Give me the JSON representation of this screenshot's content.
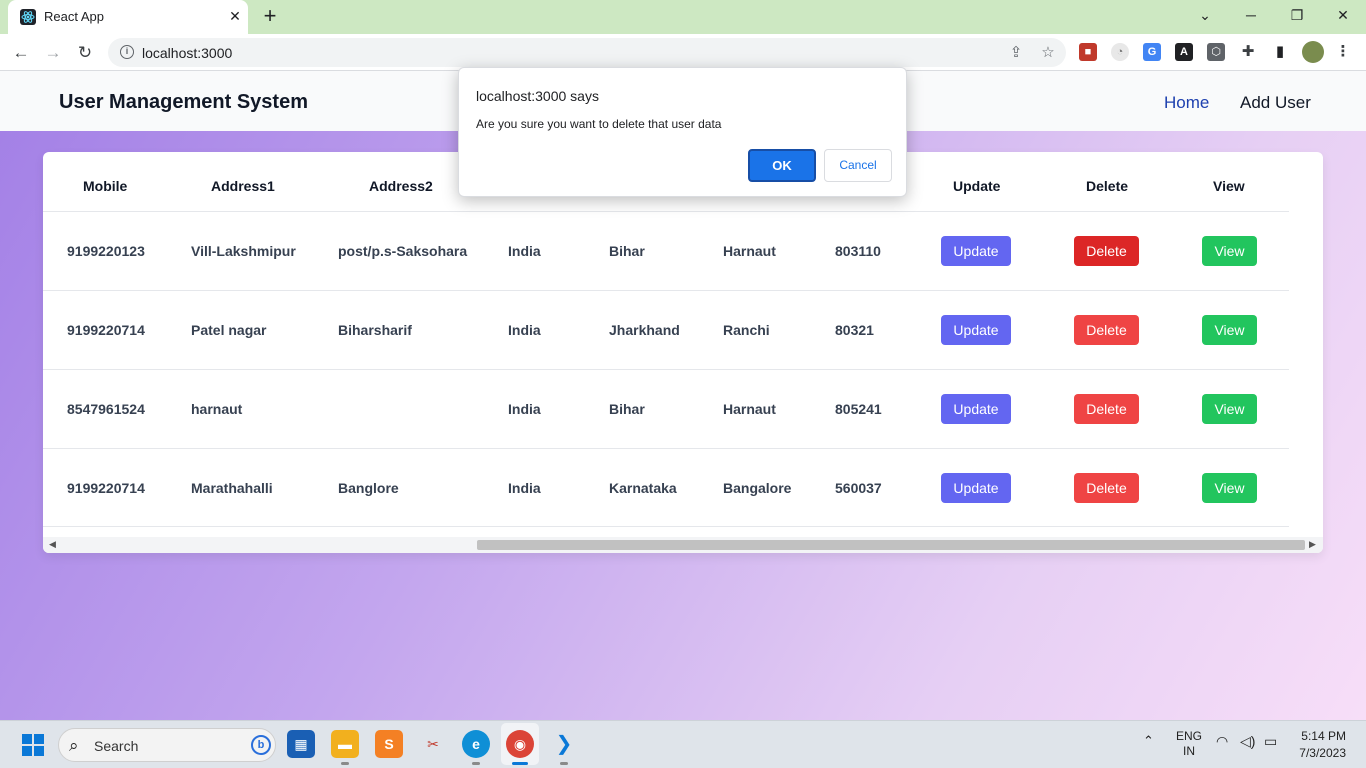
{
  "browser": {
    "tab_title": "React App",
    "url": "localhost:3000"
  },
  "app": {
    "brand": "User Management System",
    "nav": {
      "home": "Home",
      "add_user": "Add User"
    },
    "accent_colors": {
      "update": "#6366f1",
      "delete": "#ef4444",
      "view": "#22c55e",
      "home_link": "#1e40af"
    }
  },
  "table": {
    "headers": [
      "Mobile",
      "Address1",
      "Address2",
      "Update",
      "Delete",
      "View"
    ],
    "rows": [
      {
        "mobile": "9199220123",
        "address1": "Vill-Lakshmipur",
        "address2": "post/p.s-Saksohara",
        "country": "India",
        "state": "Bihar",
        "city": "Harnaut",
        "pin": "803110",
        "update": "Update",
        "delete": "Delete",
        "view": "View"
      },
      {
        "mobile": "9199220714",
        "address1": "Patel nagar",
        "address2": "Biharsharif",
        "country": "India",
        "state": "Jharkhand",
        "city": "Ranchi",
        "pin": "80321",
        "update": "Update",
        "delete": "Delete",
        "view": "View"
      },
      {
        "mobile": "8547961524",
        "address1": "harnaut",
        "address2": "",
        "country": "India",
        "state": "Bihar",
        "city": "Harnaut",
        "pin": "805241",
        "update": "Update",
        "delete": "Delete",
        "view": "View"
      },
      {
        "mobile": "9199220714",
        "address1": "Marathahalli",
        "address2": "Banglore",
        "country": "India",
        "state": "Karnataka",
        "city": "Bangalore",
        "pin": "560037",
        "update": "Update",
        "delete": "Delete",
        "view": "View"
      }
    ]
  },
  "dialog": {
    "title": "localhost:3000 says",
    "message": "Are you sure you want to delete that user data",
    "ok_label": "OK",
    "cancel_label": "Cancel"
  },
  "taskbar": {
    "search_placeholder": "Search",
    "language": "ENG",
    "region": "IN",
    "time": "5:14 PM",
    "date": "7/3/2023"
  }
}
